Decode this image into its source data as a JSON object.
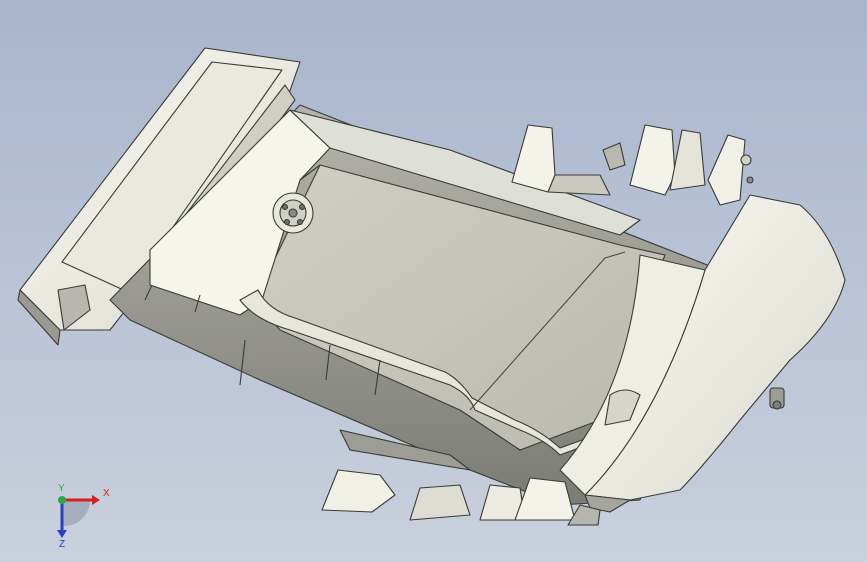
{
  "viewport": {
    "background_top": "#a9b5cc",
    "background_bottom": "#c9d0dd",
    "model_name": "",
    "model_colors": {
      "face_light": "#f1f1e8",
      "face_mid": "#d4d4cc",
      "face_inner": "#c6c6bd",
      "face_dark": "#8f8f88",
      "edge": "#3a3a36"
    }
  },
  "triad": {
    "x_label": "X",
    "y_label": "Y",
    "z_label": "Z",
    "x_color": "#d62020",
    "y_color": "#2aa84a",
    "z_color": "#2b3fc4"
  }
}
